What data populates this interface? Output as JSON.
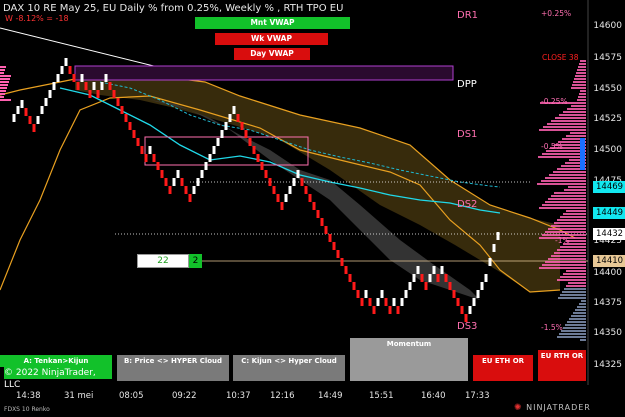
{
  "header": {
    "title": "DAX 10  RE May 25, EU Daily % from 0.25%, Weekly % , RTH TPO EU",
    "subtitle": "W -8.12% = -18"
  },
  "vwap_buttons": [
    {
      "label": "Mnt VWAP",
      "color": "#12c12a"
    },
    {
      "label": "Wk VWAP",
      "color": "#d90d0d"
    },
    {
      "label": "Day VWAP",
      "color": "#d90d0d"
    }
  ],
  "levels": {
    "dr1": "DR1",
    "dpp": "DPP",
    "ds1": "DS1",
    "ds2": "DS2",
    "ds3": "DS3",
    "close": "CLOSE 38"
  },
  "pct_labels": {
    "p1": "+0.25%",
    "p2": "-0.25%",
    "p3": "-0.5%",
    "p4": "-1%",
    "p5": "-1.5%"
  },
  "price_axis": {
    "ticks": [
      "14600",
      "14575",
      "14550",
      "14525",
      "14500",
      "14475",
      "14425",
      "14400",
      "14375",
      "14350",
      "14325"
    ],
    "tags": [
      {
        "label": "14469",
        "color": "#12e8f0"
      },
      {
        "label": "14449",
        "color": "#12e8f0"
      },
      {
        "label": "14432",
        "color": "#ffffff"
      },
      {
        "label": "14410",
        "color": "#e8c896"
      }
    ]
  },
  "time_axis": {
    "ticks": [
      "14:38",
      "31 mei",
      "08:05",
      "09:22",
      "10:37",
      "12:16",
      "14:49",
      "15:51",
      "16:40",
      "17:33"
    ]
  },
  "marker": {
    "value": "22",
    "badge": "2"
  },
  "bottom_buttons": {
    "a": "A: Tenkan>Kijun",
    "copyright": "© 2022 NinjaTrader, LLC",
    "b": "B: Price <> HYPER Cloud",
    "c": "C: Kijun <> Hyper Cloud",
    "momentum": "Momentum",
    "eu_eth_or": "EU ETH OR",
    "eu_rth_or": "EU RTH OR"
  },
  "footer": {
    "instrument": "FDXS 10 Renko",
    "brand": "NINJATRADER"
  },
  "colors": {
    "bull": "#ffffff",
    "bear": "#ff1a1a",
    "cloud": "#e8a020",
    "kijun": "#20d0e0",
    "dashed": "#20b0c8",
    "profile": "#ff60b0"
  }
}
